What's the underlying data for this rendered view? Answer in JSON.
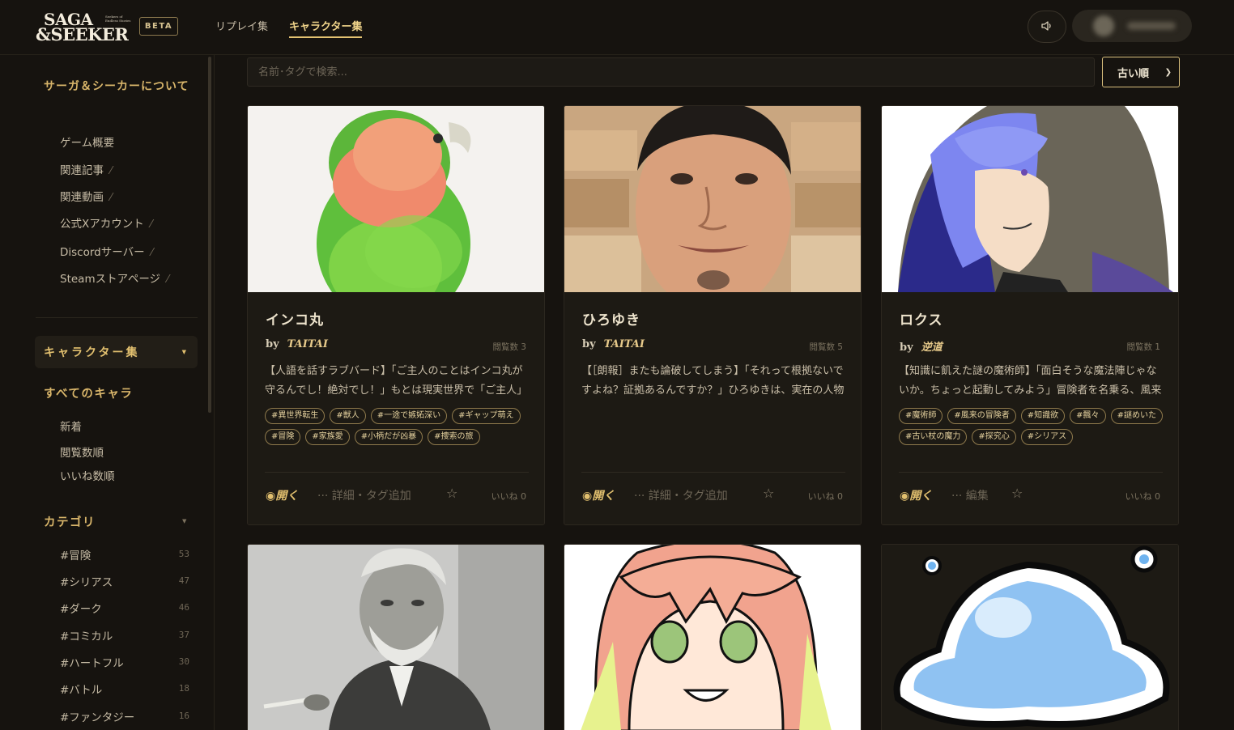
{
  "header": {
    "logo_line1": "SAGA",
    "logo_line2": "&SEEKER",
    "logo_sub": "Seekers of Endless Stories",
    "beta": "BETA",
    "nav": [
      {
        "label": "リプレイ集"
      },
      {
        "label": "キャラクター集"
      }
    ]
  },
  "sidebar": {
    "about_heading": "サーガ＆シーカーについて",
    "about_items": [
      {
        "label": "ゲーム概要",
        "ext": ""
      },
      {
        "label": "関連記事",
        "ext": "⁄"
      },
      {
        "label": "関連動画",
        "ext": "⁄"
      },
      {
        "label": "公式Xアカウント",
        "ext": "⁄"
      },
      {
        "label": "Discordサーバー",
        "ext": "⁄"
      },
      {
        "label": "Steamストアページ",
        "ext": "⁄"
      }
    ],
    "active_section": "キャラクター集",
    "all_chars_heading": "すべてのキャラ",
    "all_chars_items": [
      {
        "label": "新着"
      },
      {
        "label": "閲覧数順"
      },
      {
        "label": "いいね数順"
      }
    ],
    "category_heading": "カテゴリ",
    "categories": [
      {
        "name": "#冒険",
        "count": "53"
      },
      {
        "name": "#シリアス",
        "count": "47"
      },
      {
        "name": "#ダーク",
        "count": "46"
      },
      {
        "name": "#コミカル",
        "count": "37"
      },
      {
        "name": "#ハートフル",
        "count": "30"
      },
      {
        "name": "#バトル",
        "count": "18"
      },
      {
        "name": "#ファンタジー",
        "count": "16"
      }
    ]
  },
  "main": {
    "search_placeholder": "名前･タグで検索...",
    "sort_label": "古い順",
    "cards": [
      {
        "title": "インコ丸",
        "by": "by",
        "author": "TAITAI",
        "views": "閲覧数 3",
        "desc": "【人語を話すラブバード】「ご主人のことはインコ丸が守るんでし！絶対でし！」もとは現実世界で「ご主人」に飼わ...",
        "tags": [
          "#異世界転生",
          "#獣人",
          "#一途で嫉妬深い",
          "#ギャップ萌え",
          "#冒険",
          "#家族愛",
          "#小柄だが凶暴",
          "#捜索の旅"
        ],
        "open": "◉開く",
        "detail": "··· 詳細・タグ追加",
        "star": "☆",
        "likes": "いいね 0"
      },
      {
        "title": "ひろゆき",
        "by": "by",
        "author": "TAITAI",
        "views": "閲覧数 5",
        "desc": "【［朗報］またも論破してしまう】「それって根拠ないですよね？証拠あるんですか？」ひろゆきは、実在の人物で...",
        "tags": [],
        "open": "◉開く",
        "detail": "··· 詳細・タグ追加",
        "star": "☆",
        "likes": "いいね 0"
      },
      {
        "title": "ロクス",
        "by": "by",
        "author": "逆道",
        "views": "閲覧数 1",
        "desc": "【知識に飢えた謎の魔術師】「面白そうな魔法陣じゃないか。ちょっと起動してみよう」冒険者を名乗る、風来の...",
        "tags": [
          "#魔術師",
          "#風来の冒険者",
          "#知識欲",
          "#飄々",
          "#謎めいた",
          "#古い杖の魔力",
          "#探究心",
          "#シリアス"
        ],
        "open": "◉開く",
        "detail": "··· 編集",
        "star": "☆",
        "likes": "いいね 0"
      }
    ]
  },
  "colors": {
    "background": "#16130f",
    "accent": "#e2c06f",
    "card": "#1d1a14"
  }
}
